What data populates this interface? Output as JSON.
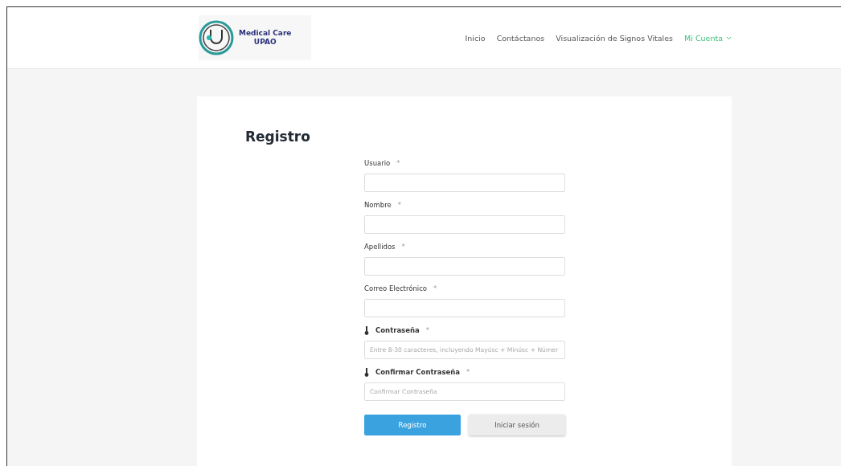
{
  "logo": {
    "line_1": "Medical Care",
    "line_2": "UPAO"
  },
  "nav": [
    {
      "label": "Inicio",
      "selected": false,
      "dropdown": false
    },
    {
      "label": "Contáctanos",
      "selected": false,
      "dropdown": false
    },
    {
      "label": "Visualización de Signos Vitales",
      "selected": false,
      "dropdown": false
    },
    {
      "label": "Mi Cuenta",
      "selected": true,
      "dropdown": true
    }
  ],
  "form": {
    "title": "Registro",
    "fields": [
      {
        "kind": "plain",
        "label": "Usuario",
        "required_mark": "*"
      },
      {
        "kind": "plain",
        "label": "Nombre",
        "required_mark": "*"
      },
      {
        "kind": "plain",
        "label": "Apellidos",
        "required_mark": "*"
      },
      {
        "kind": "plain",
        "label": "Correo Electrónico",
        "required_mark": "*"
      },
      {
        "kind": "password",
        "label": "Contraseña",
        "required_mark": "*",
        "placeholder": "Entre 8-30 caracteres, incluyendo Mayúsc + Minúsc + Númer"
      },
      {
        "kind": "password",
        "label": "Confirmar Contraseña",
        "required_mark": "*",
        "placeholder": "Confirmar Contraseña"
      }
    ],
    "buttons": [
      {
        "kind": "primary",
        "label": "Registro"
      },
      {
        "kind": "secondary",
        "label": "Iniciar sesión"
      }
    ]
  }
}
